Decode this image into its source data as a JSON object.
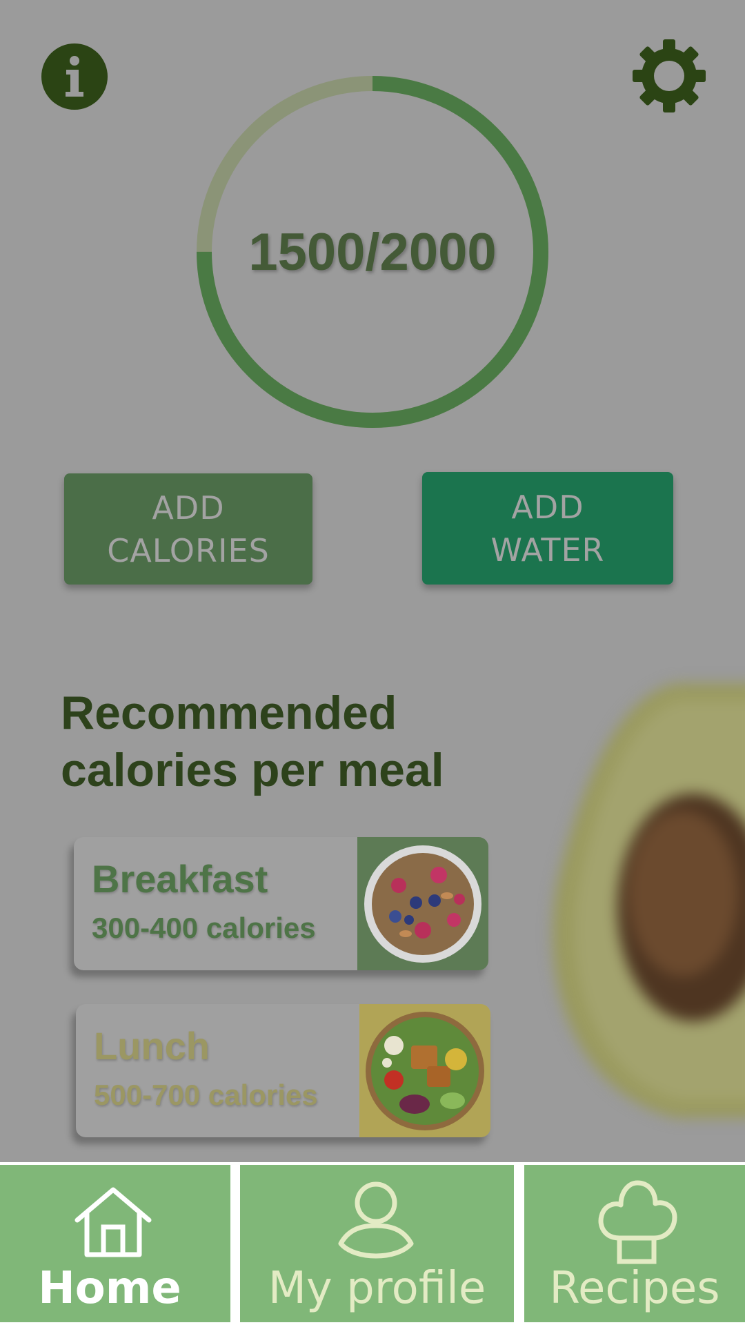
{
  "header": {
    "info_icon": "info-icon",
    "settings_icon": "gear-icon"
  },
  "calories": {
    "consumed": 1500,
    "goal": 2000,
    "display": "1500/2000",
    "ring_color": "#4a7a44",
    "ring_track_color": "#8b9477"
  },
  "actions": {
    "add_calories_label": "ADD\nCALORIES",
    "add_water_label": "ADD\nWATER"
  },
  "recommended": {
    "heading": "Recommended calories per meal",
    "meals": [
      {
        "name": "Breakfast",
        "calories": "300-400 calories",
        "image": "berry-granola-bowl"
      },
      {
        "name": "Lunch",
        "calories": "500-700 calories",
        "image": "salad-bowl"
      }
    ]
  },
  "nav": {
    "tabs": [
      {
        "label": "Home",
        "icon": "home-icon",
        "active": true
      },
      {
        "label": "My profile",
        "icon": "user-icon",
        "active": false
      },
      {
        "label": "Recipes",
        "icon": "chef-hat-icon",
        "active": false
      }
    ]
  },
  "colors": {
    "nav_background": "#80b778",
    "heading": "#2d421b",
    "add_water_button": "#1b744e",
    "add_calories_button": "#4b6e48"
  }
}
